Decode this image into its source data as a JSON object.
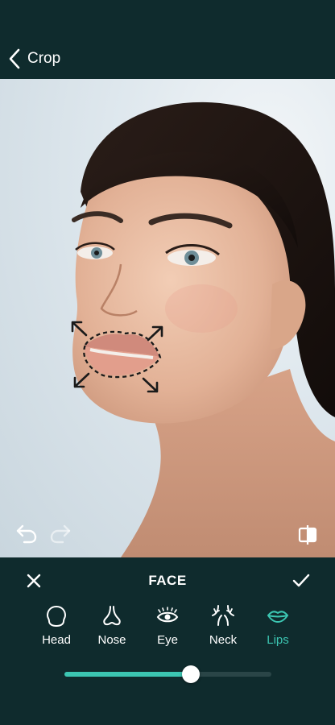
{
  "header": {
    "back_label": "Crop"
  },
  "panel": {
    "title": "FACE"
  },
  "tools": [
    {
      "label": "Head",
      "icon": "head-icon"
    },
    {
      "label": "Nose",
      "icon": "nose-icon"
    },
    {
      "label": "Eye",
      "icon": "eye-icon"
    },
    {
      "label": "Neck",
      "icon": "neck-icon"
    },
    {
      "label": "Lips",
      "icon": "lips-icon",
      "active": true
    }
  ],
  "slider": {
    "value": 0.61
  },
  "colors": {
    "accent": "#3cc6b2",
    "panel_bg": "#0f2b2d"
  }
}
